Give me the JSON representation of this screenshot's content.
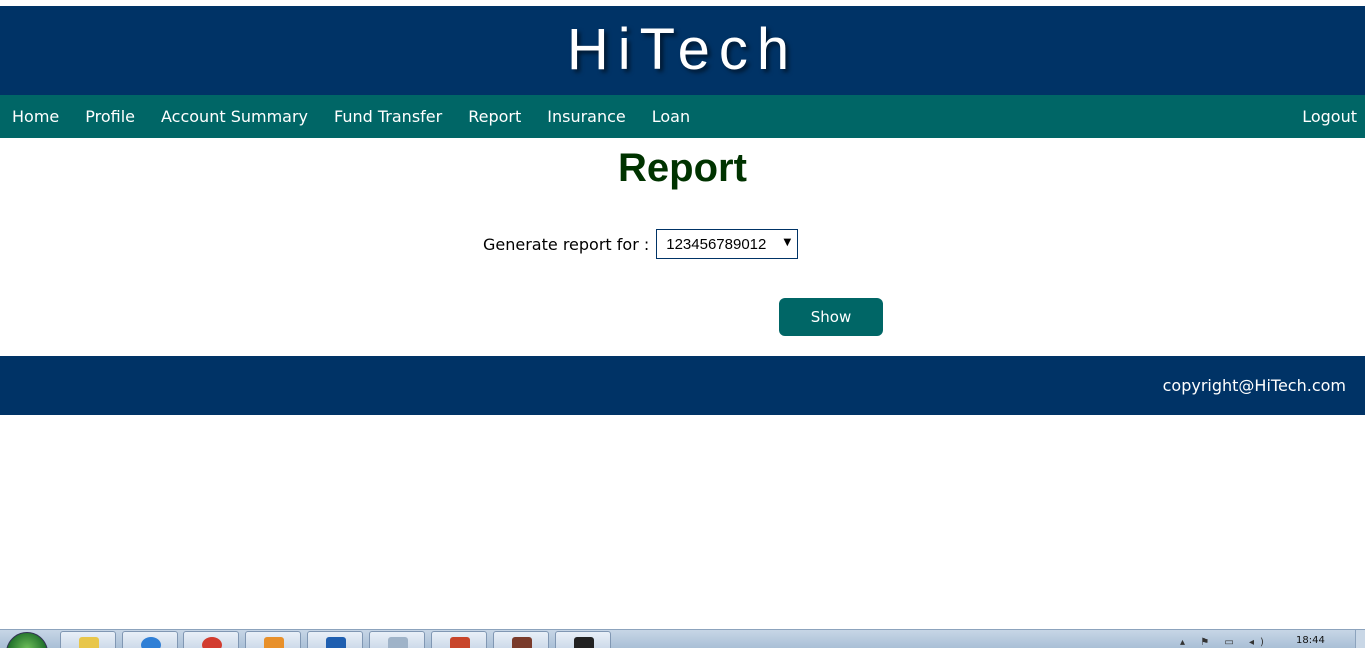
{
  "header": {
    "logo": "HiTech"
  },
  "nav": {
    "items": [
      {
        "label": "Home"
      },
      {
        "label": "Profile"
      },
      {
        "label": "Account Summary"
      },
      {
        "label": "Fund Transfer"
      },
      {
        "label": "Report"
      },
      {
        "label": "Insurance"
      },
      {
        "label": "Loan"
      }
    ],
    "logout": "Logout"
  },
  "main": {
    "title": "Report",
    "form": {
      "label": "Generate report for :",
      "account_selected": "123456789012"
    },
    "show_button": "Show"
  },
  "footer": {
    "copyright": "copyright@HiTech.com"
  },
  "taskbar": {
    "clock": "18:44",
    "pinned": [
      {
        "icon": "start-orb-icon"
      },
      {
        "icon": "folder-icon",
        "color": "#e8c64a"
      },
      {
        "icon": "internet-explorer-icon",
        "color": "#2f7fd6"
      },
      {
        "icon": "chrome-icon",
        "color": "#d23c2f"
      },
      {
        "icon": "media-player-icon",
        "color": "#e8902a"
      },
      {
        "icon": "outlook-icon",
        "color": "#1f5fb0"
      },
      {
        "icon": "notepad-icon",
        "color": "#9fb3c8"
      },
      {
        "icon": "powerpoint-icon",
        "color": "#c8452b"
      },
      {
        "icon": "java-settings-icon",
        "color": "#7a3b2b"
      },
      {
        "icon": "command-prompt-icon",
        "color": "#222222"
      }
    ]
  },
  "colors": {
    "header_bg": "#003366",
    "nav_bg": "#006666",
    "title": "#003300",
    "button_bg": "#006666",
    "footer_bg": "#003366"
  }
}
